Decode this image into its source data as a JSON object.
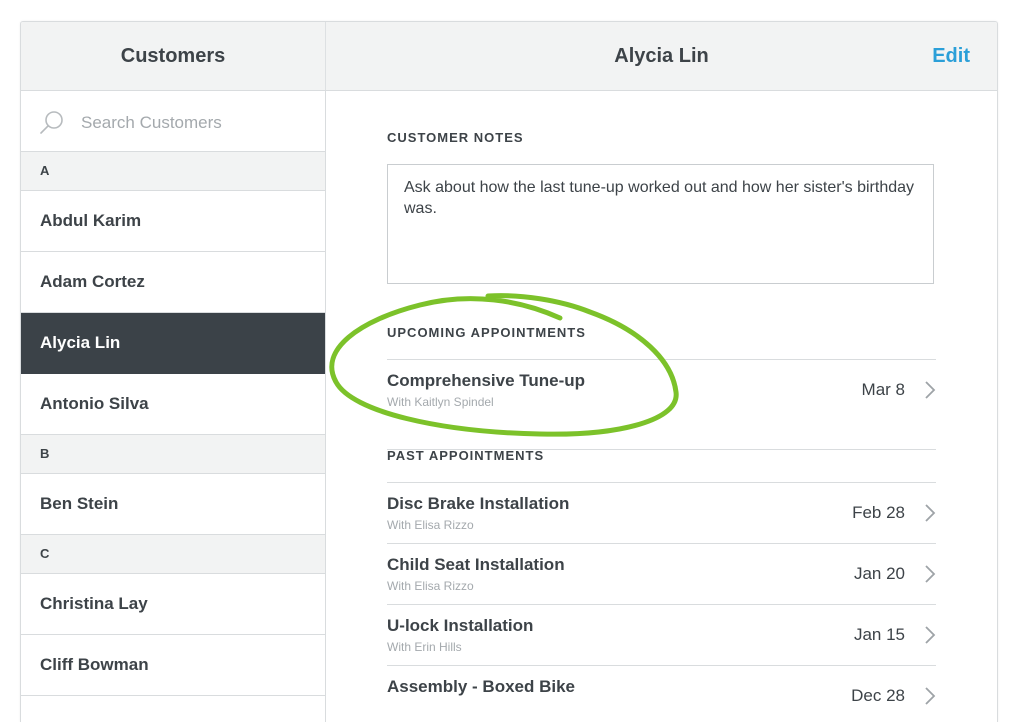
{
  "header": {
    "left_title": "Customers",
    "center_title": "Alycia Lin",
    "edit_label": "Edit"
  },
  "colors": {
    "accent": "#2b9fd8",
    "selected_row": "#3b4248",
    "annotation_green": "#7cc22a"
  },
  "sidebar": {
    "search_placeholder": "Search Customers",
    "sections": [
      {
        "letter": "A",
        "customers": [
          "Abdul Karim",
          "Adam Cortez",
          "Alycia Lin",
          "Antonio Silva"
        ]
      },
      {
        "letter": "B",
        "customers": [
          "Ben Stein"
        ]
      },
      {
        "letter": "C",
        "customers": [
          "Christina Lay",
          "Cliff Bowman"
        ]
      }
    ],
    "selected": "Alycia Lin"
  },
  "main": {
    "notes_label": "CUSTOMER NOTES",
    "notes_text": "Ask about how the last tune-up worked out and how her sister's birthday was.",
    "upcoming_label": "UPCOMING APPOINTMENTS",
    "upcoming": [
      {
        "name": "Comprehensive Tune-up",
        "with": "With Kaitlyn Spindel",
        "date": "Mar 8"
      }
    ],
    "past_label": "PAST APPOINTMENTS",
    "past": [
      {
        "name": "Disc Brake Installation",
        "with": "With Elisa Rizzo",
        "date": "Feb 28"
      },
      {
        "name": "Child Seat Installation",
        "with": "With Elisa Rizzo",
        "date": "Jan 20"
      },
      {
        "name": "U-lock Installation",
        "with": "With Erin Hills",
        "date": "Jan 15"
      },
      {
        "name": "Assembly - Boxed Bike",
        "with": "",
        "date": "Dec 28"
      }
    ]
  }
}
